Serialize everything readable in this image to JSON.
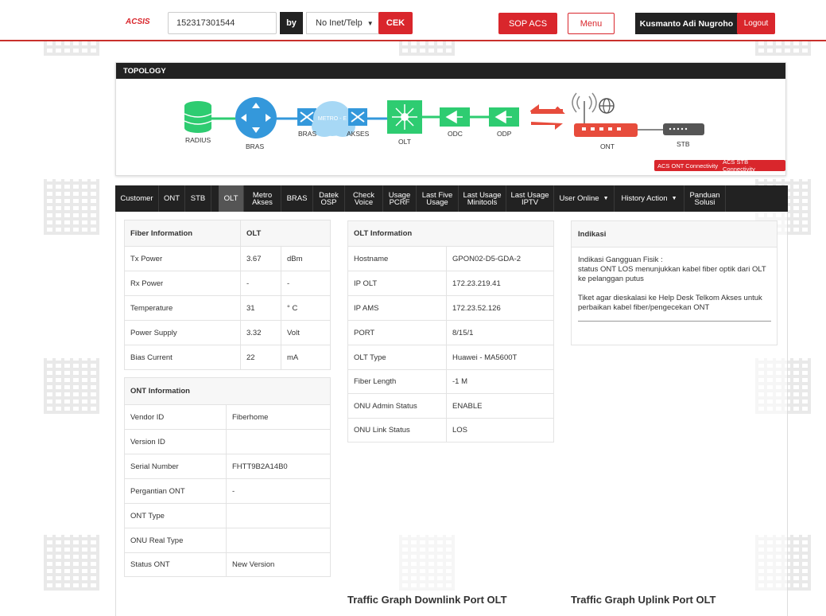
{
  "header": {
    "logo": "ACSIS",
    "search_value": "152317301544",
    "by_label": "by",
    "search_type": "No Inet/Telp",
    "cek_label": "CEK",
    "sop_label": "SOP ACS",
    "menu_label": "Menu",
    "user_name": "Kusmanto Adi Nugroho",
    "logout_label": "Logout"
  },
  "topology": {
    "title": "TOPOLOGY",
    "nodes": {
      "radius": "RADIUS",
      "bras": "BRAS",
      "bras2": "BRAS",
      "metro": "METRO - E",
      "akses": "AKSES",
      "olt": "OLT",
      "odc": "ODC",
      "odp": "ODP",
      "ont": "ONT",
      "stb": "STB"
    },
    "acs_ont": "ACS ONT Connectivity",
    "acs_stb": "ACS STB Connectivity",
    "colors": {
      "green": "#2ecc71",
      "blue": "#3498db",
      "red": "#e74c3c",
      "gray": "#555555"
    }
  },
  "nav": {
    "tabs": [
      {
        "l1": "Customer",
        "l2": ""
      },
      {
        "l1": "ONT",
        "l2": ""
      },
      {
        "l1": "STB",
        "l2": ""
      },
      {
        "l1": "OLT",
        "l2": ""
      },
      {
        "l1": "Metro",
        "l2": "Akses"
      },
      {
        "l1": "BRAS",
        "l2": ""
      },
      {
        "l1": "Datek",
        "l2": "OSP"
      },
      {
        "l1": "Check",
        "l2": "Voice"
      },
      {
        "l1": "Usage",
        "l2": "PCRF"
      },
      {
        "l1": "Last Five",
        "l2": "Usage"
      },
      {
        "l1": "Last Usage",
        "l2": "Minitools"
      },
      {
        "l1": "Last Usage",
        "l2": "IPTV"
      },
      {
        "l1": "User Online",
        "l2": ""
      },
      {
        "l1": "History Action",
        "l2": ""
      },
      {
        "l1": "Panduan",
        "l2": "Solusi"
      }
    ],
    "active": "OLT"
  },
  "fiber": {
    "header": [
      "Fiber Information",
      "OLT",
      ""
    ],
    "rows": [
      [
        "Tx Power",
        "3.67",
        "dBm"
      ],
      [
        "Rx Power",
        "-",
        "-"
      ],
      [
        "Temperature",
        "31",
        "° C"
      ],
      [
        "Power Supply",
        "3.32",
        "Volt"
      ],
      [
        "Bias Current",
        "22",
        "mA"
      ]
    ]
  },
  "ont": {
    "header": "ONT Information",
    "rows": [
      [
        "Vendor ID",
        "Fiberhome"
      ],
      [
        "Version ID",
        ""
      ],
      [
        "Serial Number",
        "FHTT9B2A14B0"
      ],
      [
        "Pergantian ONT",
        "-"
      ],
      [
        "ONT Type",
        ""
      ],
      [
        "ONU Real Type",
        ""
      ],
      [
        "Status ONT",
        "New Version"
      ]
    ]
  },
  "olt": {
    "header": "OLT Information",
    "rows": [
      [
        "Hostname",
        "GPON02-D5-GDA-2"
      ],
      [
        "IP OLT",
        "172.23.219.41"
      ],
      [
        "IP AMS",
        "172.23.52.126"
      ],
      [
        "PORT",
        "8/15/1"
      ],
      [
        "OLT Type",
        "Huawei - MA5600T"
      ],
      [
        "Fiber Length",
        "-1 M"
      ],
      [
        "ONU Admin Status",
        "ENABLE"
      ],
      [
        "ONU Link Status",
        "LOS"
      ]
    ]
  },
  "indikasi": {
    "header": "Indikasi",
    "line1": "Indikasi Gangguan Fisik :",
    "line2": "status ONT LOS menunjukkan kabel fiber optik dari OLT ke pelanggan putus",
    "line3": "Tiket agar dieskalasi ke Help Desk Telkom Akses untuk perbaikan kabel fiber/pengecekan ONT"
  },
  "graphs": {
    "downlink": "Traffic Graph Downlink Port OLT",
    "uplink": "Traffic Graph Uplink Port OLT"
  }
}
